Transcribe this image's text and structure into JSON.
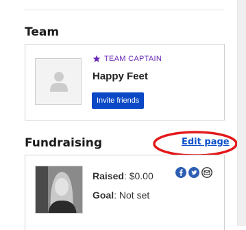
{
  "team": {
    "heading": "Team",
    "captain_label": "TEAM CAPTAIN",
    "team_name": "Happy Feet",
    "invite_label": "Invite friends"
  },
  "fundraising": {
    "heading": "Fundraising",
    "edit_label": "Edit page",
    "raised_label": "Raised",
    "raised_value": "$0.00",
    "goal_label": "Goal",
    "goal_value": "Not set"
  },
  "icons": {
    "star": "star-icon",
    "user": "user-placeholder-icon",
    "facebook": "facebook-icon",
    "twitter": "twitter-icon",
    "email": "email-icon"
  },
  "colors": {
    "accent_purple": "#6a2ab5",
    "button_blue": "#0a48c6",
    "link_blue": "#0b4fc8",
    "annotation_red": "#e3181b",
    "share_blue": "#2d5fb3"
  }
}
